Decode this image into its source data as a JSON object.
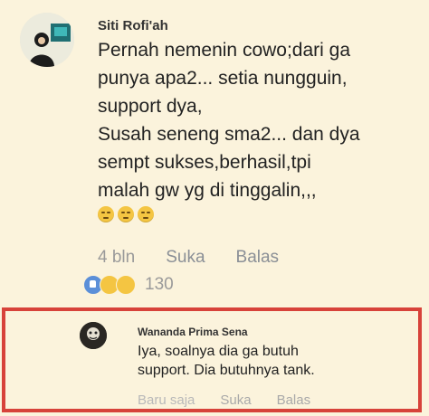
{
  "comment": {
    "author": "Siti Rofi'ah",
    "text": "Pernah nemenin cowo;dari ga\npunya apa2... setia nungguin,\nsupport dya,\nSusah seneng sma2... dan dya\nsempt sukses,berhasil,tpi\nmalah gw yg di tinggalin,,,",
    "time": "4 bln",
    "like_label": "Suka",
    "reply_label": "Balas",
    "reaction_count": "130",
    "colors": {
      "text": "#222222",
      "meta": "#9a9a9a",
      "background": "#fbf3dc"
    }
  },
  "reply": {
    "author": "Wananda Prima Sena",
    "text": "Iya, soalnya dia ga butuh\nsupport. Dia butuhnya tank.",
    "time": "Baru saja",
    "like_label": "Suka",
    "reply_label": "Balas",
    "colors": {
      "border": "#d7423a"
    }
  }
}
